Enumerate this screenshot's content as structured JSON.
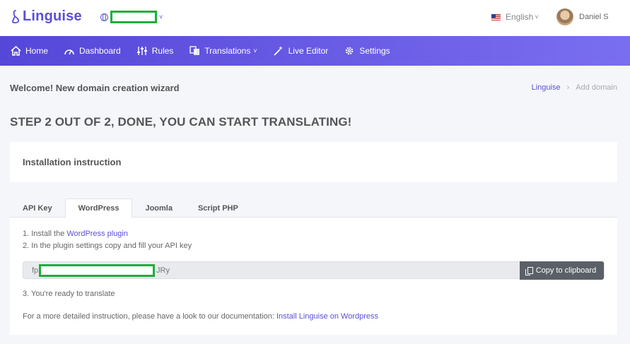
{
  "brand": {
    "name": "Linguise"
  },
  "header": {
    "domain_caret": "˅",
    "language": "English",
    "language_caret": "˅",
    "user_name": "Daniel S"
  },
  "nav": {
    "items": [
      {
        "label": "Home",
        "icon": "home-icon"
      },
      {
        "label": "Dashboard",
        "icon": "gauge-icon"
      },
      {
        "label": "Rules",
        "icon": "sliders-icon"
      },
      {
        "label": "Translations",
        "icon": "translate-icon",
        "caret": "˅"
      },
      {
        "label": "Live Editor",
        "icon": "magic-wand-icon"
      },
      {
        "label": "Settings",
        "icon": "gear-icon"
      }
    ]
  },
  "page": {
    "welcome": "Welcome! New domain creation wizard",
    "breadcrumb": {
      "root": "Linguise",
      "separator": "›",
      "current": "Add domain"
    },
    "step_title": "STEP 2 OUT OF 2, DONE, YOU CAN START TRANSLATING!"
  },
  "card": {
    "title": "Installation instruction"
  },
  "tabs": [
    "API Key",
    "WordPress",
    "Joomla",
    "Script PHP"
  ],
  "active_tab": "WordPress",
  "instructions": {
    "step1_prefix": "1. Install the ",
    "step1_link": "WordPress plugin",
    "step2": "2. In the plugin settings copy and fill your API key",
    "api_key_prefix": "fp",
    "api_key_suffix": "JRy",
    "copy_button": "Copy to clipboard",
    "step3": "3. You're ready to translate",
    "doc_prefix": "For a more detailed instruction, please have a look to our documentation: ",
    "doc_link": "Install Linguise on Wordpress"
  },
  "colors": {
    "accent": "#5a4fd6",
    "nav_gradient_start": "#5547d8",
    "nav_gradient_end": "#7a6ef0",
    "redaction": "#1fae3c",
    "copy_button": "#5b6068"
  }
}
